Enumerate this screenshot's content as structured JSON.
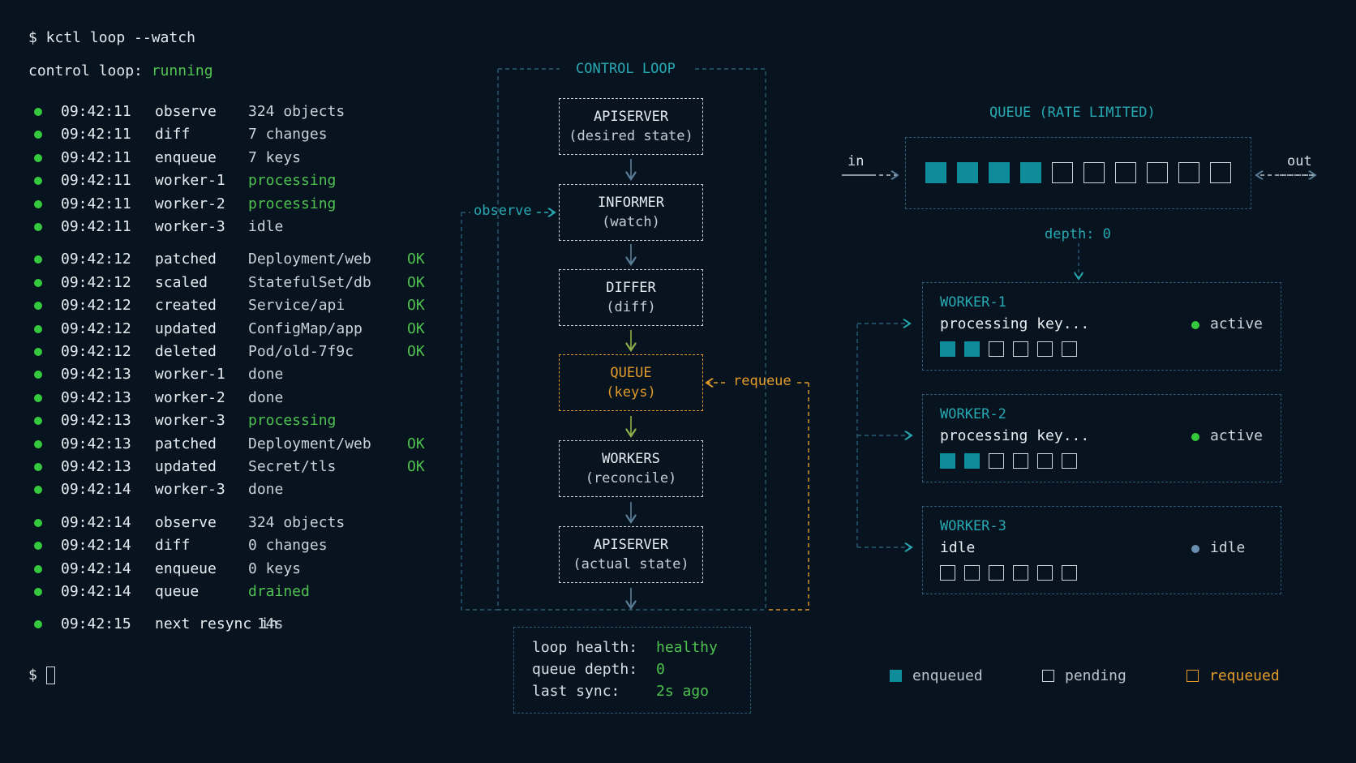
{
  "terminal": {
    "prompt": "$ kctl loop --watch",
    "status_label": "control loop: ",
    "status_value": "running",
    "cursor_prompt": "$"
  },
  "log": [
    {
      "time": "09:42:11",
      "action": "observe",
      "object": "324 objects",
      "result": "",
      "object_color": "dim"
    },
    {
      "time": "09:42:11",
      "action": "diff",
      "object": "7 changes",
      "result": "",
      "object_color": "dim"
    },
    {
      "time": "09:42:11",
      "action": "enqueue",
      "object": "7 keys",
      "result": "",
      "object_color": "dim"
    },
    {
      "time": "09:42:11",
      "action": "worker-1",
      "object": "processing",
      "result": "",
      "object_color": "green"
    },
    {
      "time": "09:42:11",
      "action": "worker-2",
      "object": "processing",
      "result": "",
      "object_color": "green"
    },
    {
      "time": "09:42:11",
      "action": "worker-3",
      "object": "idle",
      "result": "",
      "object_color": "dim"
    },
    {
      "time": "09:42:12",
      "action": "patched",
      "object": "Deployment/web",
      "result": "OK",
      "object_color": "dim"
    },
    {
      "time": "09:42:12",
      "action": "scaled",
      "object": "StatefulSet/db",
      "result": "OK",
      "object_color": "dim"
    },
    {
      "time": "09:42:12",
      "action": "created",
      "object": "Service/api",
      "result": "OK",
      "object_color": "dim"
    },
    {
      "time": "09:42:12",
      "action": "updated",
      "object": "ConfigMap/app",
      "result": "OK",
      "object_color": "dim"
    },
    {
      "time": "09:42:12",
      "action": "deleted",
      "object": "Pod/old-7f9c",
      "result": "OK",
      "object_color": "dim"
    },
    {
      "time": "09:42:13",
      "action": "worker-1",
      "object": "done",
      "result": "",
      "object_color": "dim"
    },
    {
      "time": "09:42:13",
      "action": "worker-2",
      "object": "done",
      "result": "",
      "object_color": "dim"
    },
    {
      "time": "09:42:13",
      "action": "worker-3",
      "object": "processing",
      "result": "",
      "object_color": "green"
    },
    {
      "time": "09:42:13",
      "action": "patched",
      "object": "Deployment/web",
      "result": "OK",
      "object_color": "dim"
    },
    {
      "time": "09:42:13",
      "action": "updated",
      "object": "Secret/tls",
      "result": "OK",
      "object_color": "dim"
    },
    {
      "time": "09:42:14",
      "action": "worker-3",
      "object": "done",
      "result": "",
      "object_color": "dim"
    },
    {
      "time": "09:42:14",
      "action": "observe",
      "object": "324 objects",
      "result": "",
      "object_color": "dim"
    },
    {
      "time": "09:42:14",
      "action": "diff",
      "object": "0 changes",
      "result": "",
      "object_color": "dim"
    },
    {
      "time": "09:42:14",
      "action": "enqueue",
      "object": "0 keys",
      "result": "",
      "object_color": "dim"
    },
    {
      "time": "09:42:14",
      "action": "queue",
      "object": "drained",
      "result": "",
      "object_color": "green"
    },
    {
      "time": "09:42:15",
      "action": "next resync in",
      "object": " 14s",
      "result": "",
      "object_color": "dim"
    }
  ],
  "control_loop": {
    "title": "CONTROL LOOP",
    "nodes": [
      {
        "title": "APISERVER",
        "sub": "(desired state)"
      },
      {
        "title": "INFORMER",
        "sub": "(watch)"
      },
      {
        "title": "DIFFER",
        "sub": "(diff)"
      },
      {
        "title": "QUEUE",
        "sub": "(keys)"
      },
      {
        "title": "WORKERS",
        "sub": "(reconcile)"
      },
      {
        "title": "APISERVER",
        "sub": "(actual state)"
      }
    ],
    "observe_label": "observe",
    "requeue_label": "requeue"
  },
  "health": {
    "loop_health_label": "loop health:",
    "loop_health_value": "healthy",
    "queue_depth_label": "queue depth:",
    "queue_depth_value": "0",
    "last_sync_label": "last sync:",
    "last_sync_value": "2s ago"
  },
  "queue": {
    "title": "QUEUE (RATE LIMITED)",
    "in_label": "in",
    "out_label": "out",
    "filled_slots": 4,
    "total_slots": 10,
    "depth_label": "depth: 0"
  },
  "workers": [
    {
      "name": "WORKER-1",
      "task": "processing key...",
      "status": "active",
      "status_color": "#35c93d",
      "filled": 2,
      "total": 6
    },
    {
      "name": "WORKER-2",
      "task": "processing key...",
      "status": "active",
      "status_color": "#35c93d",
      "filled": 2,
      "total": 6
    },
    {
      "name": "WORKER-3",
      "task": "idle",
      "status": "idle",
      "status_color": "#6b8fb0",
      "filled": 0,
      "total": 6
    }
  ],
  "legend": {
    "enqueued": "enqueued",
    "pending": "pending",
    "requeued": "requeued"
  },
  "colors": {
    "background": "#07141f",
    "accent_teal": "#27a9b3",
    "ok_green": "#4fc14f",
    "requeue_orange": "#e29a2a",
    "slot_fill": "#0e8c9a"
  }
}
